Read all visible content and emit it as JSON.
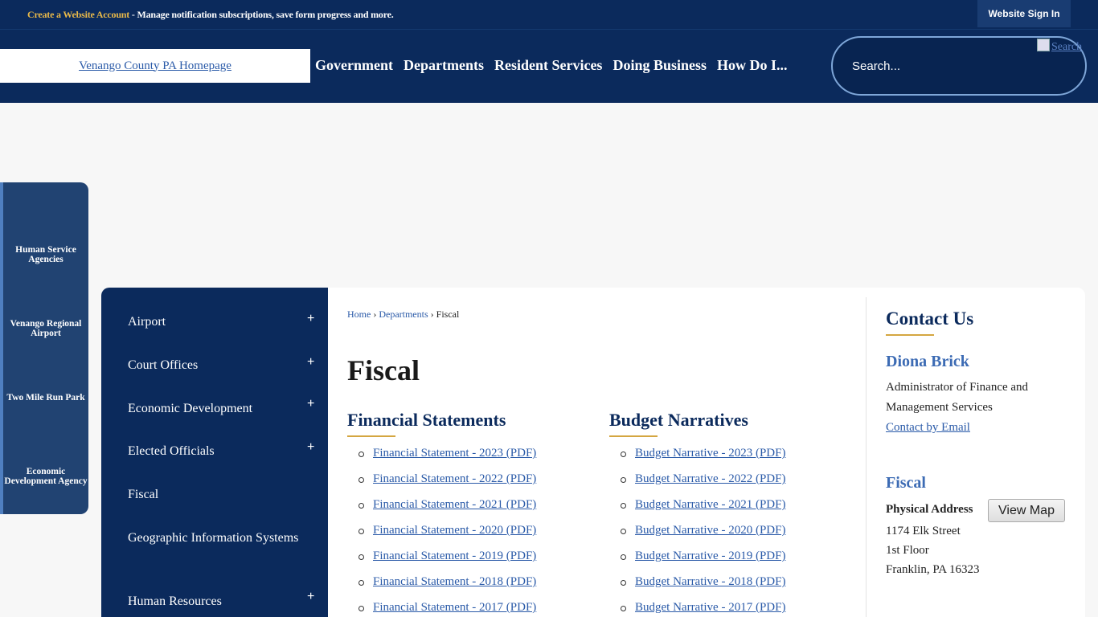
{
  "topbar": {
    "account_link": "Create a Website Account",
    "account_desc": " - Manage notification subscriptions, save form progress and more.",
    "sign_in": "Website Sign In"
  },
  "header": {
    "logo_alt": "Venango County PA Homepage",
    "nav": [
      "Government",
      "Departments",
      "Resident Services",
      "Doing Business",
      "How Do I..."
    ],
    "search_placeholder": "Search...",
    "search_button_alt": "Search"
  },
  "quick_links": [
    "Human Service Agencies",
    "Venango Regional Airport",
    "Two Mile Run Park",
    "Economic Development Agency"
  ],
  "subnav": [
    {
      "label": "Airport",
      "expandable": true
    },
    {
      "label": "Court Offices",
      "expandable": true
    },
    {
      "label": "Economic Development",
      "expandable": true
    },
    {
      "label": "Elected Officials",
      "expandable": true
    },
    {
      "label": "Fiscal",
      "expandable": false
    },
    {
      "label": "Geographic Information Systems",
      "expandable": false
    },
    {
      "label": "Human Resources",
      "expandable": true
    }
  ],
  "breadcrumb": {
    "home": "Home",
    "sep": "›",
    "departments": "Departments",
    "current": "Fiscal"
  },
  "page_title": "Fiscal",
  "financial_statements": {
    "heading": "Financial Statements",
    "items": [
      "Financial Statement - 2023 (PDF)",
      "Financial Statement - 2022 (PDF)",
      "Financial Statement - 2021 (PDF)",
      "Financial Statement - 2020 (PDF)",
      "Financial Statement - 2019 (PDF)",
      "Financial Statement - 2018 (PDF)",
      "Financial Statement - 2017 (PDF)"
    ]
  },
  "budget_narratives": {
    "heading": "Budget Narratives",
    "items": [
      "Budget Narrative - 2023 (PDF)",
      "Budget Narrative - 2022 (PDF)",
      "Budget Narrative - 2021 (PDF)",
      "Budget Narrative - 2020 (PDF)",
      "Budget Narrative - 2019 (PDF)",
      "Budget Narrative - 2018 (PDF)",
      "Budget Narrative - 2017 (PDF)"
    ]
  },
  "contact": {
    "heading": "Contact Us",
    "name": "Diona Brick",
    "role": "Administrator of Finance and Management Services",
    "email_link": "Contact by Email",
    "department": "Fiscal",
    "address_label": "Physical Address",
    "map_button": "View Map",
    "address_line1": "1174 Elk Street",
    "address_line2": "1st Floor",
    "address_line3": "Franklin, PA 16323"
  },
  "colors": {
    "navy": "#0b2a5c",
    "accent_gold": "#d4a640",
    "link_blue": "#2a5aa8"
  }
}
